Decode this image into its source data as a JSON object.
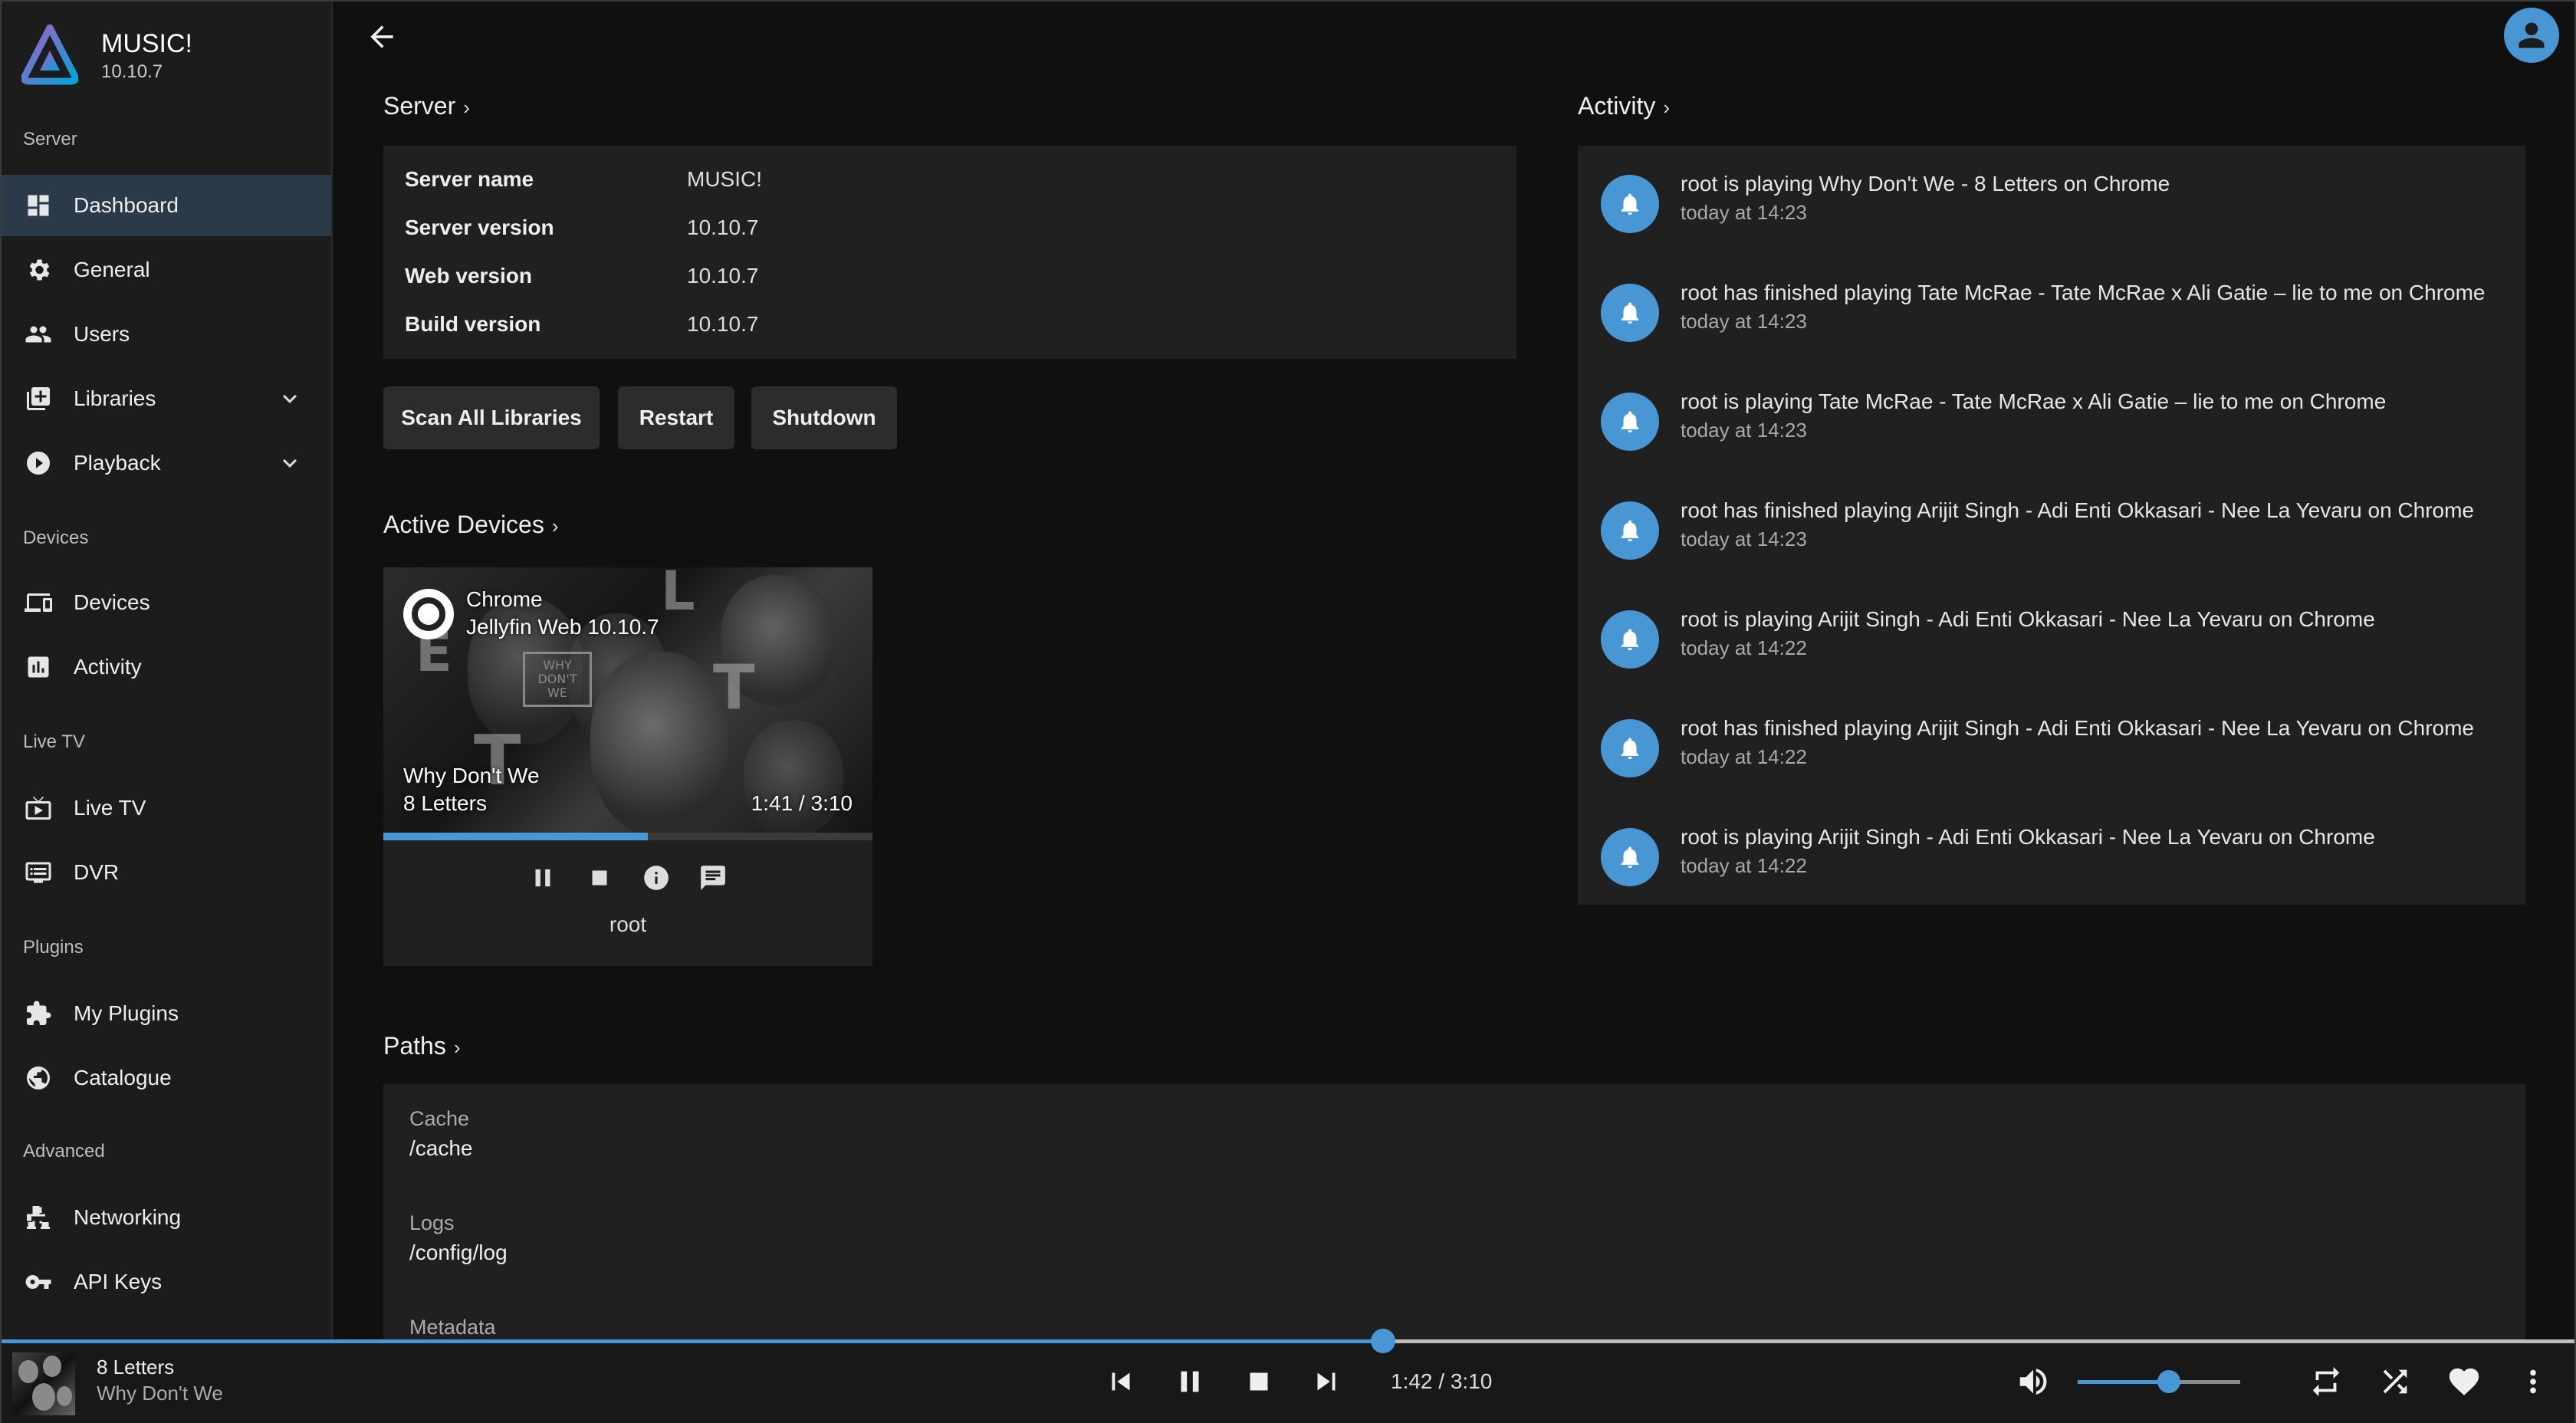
{
  "app": {
    "name": "MUSIC!",
    "version": "10.10.7"
  },
  "colors": {
    "accent": "#4896d3",
    "sidebar_bg": "#1c1c1c",
    "panel_bg": "#202020",
    "active_bg": "#2b3a48"
  },
  "sidebar": {
    "sections": {
      "server": "Server",
      "devices": "Devices",
      "live_tv": "Live TV",
      "plugins": "Plugins",
      "advanced": "Advanced"
    },
    "items": {
      "dashboard": {
        "label": "Dashboard",
        "icon": "dashboard-icon"
      },
      "general": {
        "label": "General",
        "icon": "gear-icon"
      },
      "users": {
        "label": "Users",
        "icon": "people-icon"
      },
      "libraries": {
        "label": "Libraries",
        "icon": "library-add-icon"
      },
      "playback": {
        "label": "Playback",
        "icon": "play-circle-icon"
      },
      "devices": {
        "label": "Devices",
        "icon": "devices-icon"
      },
      "activity": {
        "label": "Activity",
        "icon": "bar-chart-icon"
      },
      "livetv": {
        "label": "Live TV",
        "icon": "tv-icon"
      },
      "dvr": {
        "label": "DVR",
        "icon": "dvr-icon"
      },
      "myplugins": {
        "label": "My Plugins",
        "icon": "puzzle-icon"
      },
      "catalogue": {
        "label": "Catalogue",
        "icon": "globe-icon"
      },
      "networking": {
        "label": "Networking",
        "icon": "network-icon"
      },
      "apikeys": {
        "label": "API Keys",
        "icon": "key-icon"
      }
    }
  },
  "server": {
    "heading": "Server",
    "rows": [
      {
        "key": "Server name",
        "value": "MUSIC!"
      },
      {
        "key": "Server version",
        "value": "10.10.7"
      },
      {
        "key": "Web version",
        "value": "10.10.7"
      },
      {
        "key": "Build version",
        "value": "10.10.7"
      }
    ],
    "buttons": {
      "scan": "Scan All Libraries",
      "restart": "Restart",
      "shutdown": "Shutdown"
    }
  },
  "active_devices": {
    "heading": "Active Devices",
    "device": {
      "name": "Chrome",
      "client": "Jellyfin Web 10.10.7",
      "now_playing_title": "Why Don't We",
      "now_playing_sub": "8 Letters",
      "time": "1:41 / 3:10",
      "progress": 0.54,
      "user": "root"
    }
  },
  "activity": {
    "heading": "Activity",
    "items": [
      {
        "text": "root is playing Why Don't We - 8 Letters on Chrome",
        "time": "today at 14:23"
      },
      {
        "text": "root has finished playing Tate McRae - Tate McRae x Ali Gatie – lie to me on Chrome",
        "time": "today at 14:23"
      },
      {
        "text": "root is playing Tate McRae - Tate McRae x Ali Gatie – lie to me on Chrome",
        "time": "today at 14:23"
      },
      {
        "text": "root has finished playing Arijit Singh - Adi Enti Okkasari - Nee La Yevaru on Chrome",
        "time": "today at 14:23"
      },
      {
        "text": "root is playing Arijit Singh - Adi Enti Okkasari - Nee La Yevaru on Chrome",
        "time": "today at 14:22"
      },
      {
        "text": "root has finished playing Arijit Singh - Adi Enti Okkasari - Nee La Yevaru on Chrome",
        "time": "today at 14:22"
      },
      {
        "text": "root is playing Arijit Singh - Adi Enti Okkasari - Nee La Yevaru on Chrome",
        "time": "today at 14:22"
      }
    ]
  },
  "paths": {
    "heading": "Paths",
    "items": [
      {
        "key": "Cache",
        "value": "/cache"
      },
      {
        "key": "Logs",
        "value": "/config/log"
      },
      {
        "key": "Metadata",
        "value": ""
      }
    ]
  },
  "player": {
    "title": "8 Letters",
    "artist": "Why Don't We",
    "time": "1:42 / 3:10",
    "progress": 0.537,
    "volume": 0.56
  }
}
